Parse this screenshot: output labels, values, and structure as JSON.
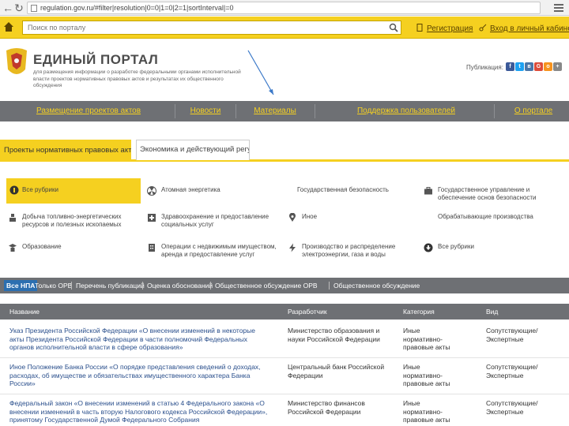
{
  "browser": {
    "url": "regulation.gov.ru/#filter|resolution|0=0|1=0|2=1|sortInterval|=0"
  },
  "topbar": {
    "search_placeholder": "Поиск по порталу",
    "register_label": "Регистрация",
    "login_label": "Вход в личный кабинет"
  },
  "header": {
    "title": "ЕДИНЫЙ ПОРТАЛ",
    "subtitle": "для размещения информации о разработке федеральными органами исполнительной власти проектов нормативных правовых актов и результатах их общественного обсуждения",
    "share_label": "Публикация:"
  },
  "share_icons": [
    "f",
    "t",
    "в",
    "G",
    "o",
    "+"
  ],
  "colors": {
    "accent_yellow": "#f5d020",
    "nav_gray": "#6e7074",
    "link_blue": "#2a4f8c",
    "badge_blue": "#2c6fb0"
  },
  "nav": {
    "items": [
      "Размещение проектов актов",
      "Новости",
      "Материалы",
      "Поддержка пользователей",
      "О портале"
    ]
  },
  "tabs": {
    "active": "Проекты нормативных правовых актов",
    "inactive": "Экономика и действующий регулирование"
  },
  "categories": {
    "all": {
      "label": "Все рубрики",
      "icon": "list-icon"
    },
    "atom": {
      "label": "Атомная энергетика",
      "icon": "radiation-icon"
    },
    "security": {
      "label": "Государственная безопасность",
      "icon": ""
    },
    "gov_admin": {
      "label": "Государственное управление и обеспечение основ безопасности",
      "icon": "briefcase-icon"
    },
    "oil": {
      "label": "Добыча топливно-энергетических ресурсов и полезных ископаемых",
      "icon": "oil-pump-icon"
    },
    "health": {
      "label": "Здравоохранение и предоставление социальных услуг",
      "icon": "medical-icon"
    },
    "other": {
      "label": "Иное",
      "icon": "map-pin-icon"
    },
    "manufacturing": {
      "label": "Обрабатывающие производства",
      "icon": ""
    },
    "education": {
      "label": "Образование",
      "icon": "graduate-icon"
    },
    "real_estate": {
      "label": "Операции с недвижимым имуществом, аренда и предоставление услуг",
      "icon": "building-icon"
    },
    "energy": {
      "label": "Производство и распределение электроэнергии, газа и воды",
      "icon": "lightning-icon"
    },
    "all_rubrics": {
      "label": "Все рубрики",
      "icon": "arrow-circle-icon"
    }
  },
  "filters": {
    "active": "Все НПА",
    "items": [
      "Только ОРВ",
      "Перечень публикаций",
      "Оценка обоснований",
      "Общественное обсуждение ОРВ",
      "Общественное обсуждение"
    ]
  },
  "table": {
    "headers": [
      "Название",
      "Разработчик",
      "Категория",
      "Вид"
    ],
    "rows": [
      {
        "title": "Указ Президента Российской Федерации «О внесении изменений в некоторые акты Президента Российской Федерации в части полномочий Федеральных органов исполнительной власти в сфере образования»",
        "developer": "Министерство образования и науки Российской Федерации",
        "category": "Иные нормативно-правовые акты",
        "type": "Сопутствующие/ Экспертные"
      },
      {
        "title": "Иное Положение Банка России «О порядке представления сведений о доходах, расходах, об имуществе и обязательствах имущественного характера Банка России»",
        "developer": "Центральный банк Российской Федерации",
        "category": "Иные нормативно-правовые акты",
        "type": "Сопутствующие/ Экспертные"
      },
      {
        "title": "Федеральный закон «О внесении изменений в статью 4 Федерального закона «О внесении изменений в часть вторую Налогового кодекса Российской Федерации», принятому Государственной Думой Федерального Собрания",
        "developer": "Министерство финансов Российской Федерации",
        "category": "Иные нормативно-правовые акты",
        "type": "Сопутствующие/ Экспертные"
      }
    ]
  }
}
